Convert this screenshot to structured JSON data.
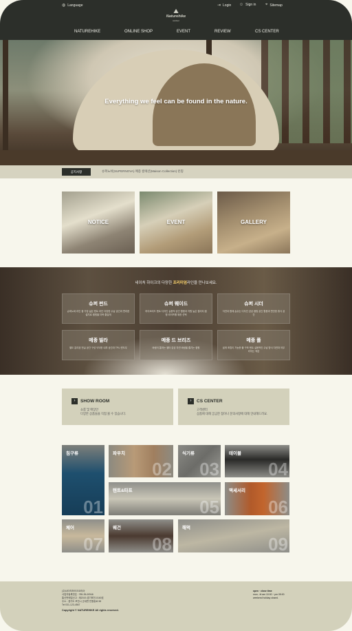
{
  "utility": {
    "language": "Language",
    "login": "Login",
    "signin": "Sign in",
    "sitemap": "Sitemap"
  },
  "logo": {
    "name": "Naturehike",
    "sub": "outdoor"
  },
  "nav": [
    "NATUREHIKE",
    "ONLINE SHOP",
    "EVENT",
    "REVIEW",
    "CS CENTER"
  ],
  "hero": {
    "headline": "Everything we feel can be found in the nature."
  },
  "notice": {
    "tag": "공지사항",
    "text": "슈퍼노바(SUPERNOVA) 메종 컬렉션(Maison Collection) 런칭"
  },
  "cards": [
    "NOTICE",
    "EVENT",
    "GALLERY"
  ],
  "brands": {
    "intro_pre": "네이처 하이크의 다양한 ",
    "intro_highlight": "프리미엄",
    "intro_post": "라인을 만나보세요.",
    "items": [
      {
        "title": "슈퍼 펀드",
        "desc": "슈퍼노바 라인 중 가장 넓은 텐트 라인 다양한 수납 공간과 편리한 설치로 캠핑을 더욱 즐겁게"
      },
      {
        "title": "슈퍼 웨이드",
        "desc": "하이브리드 텐트 디자인 실용적 공간 활용과 차원 높은 퀄리티 캠핑 라이프를 위한 선택"
      },
      {
        "title": "슈퍼 시더",
        "desc": "자연과 함께 숨쉬는 디자인 감성 캠핑 공간 활용과 편안한 휴식 공간"
      },
      {
        "title": "메종 빌라",
        "desc": "별도 분리된 전실 공간 구성 넉넉한 내부 공간과 TPU 윈도우"
      },
      {
        "title": "메종 드 브리즈",
        "desc": "바람이 통하는 쉘터 감성 자연 바람을 즐기는 캠핑"
      },
      {
        "title": "메종 폴",
        "desc": "쉽게 조립이 가능한 폴 구조 텐트 실용적인 수납 방식 자연과 어우러지는 색감"
      }
    ]
  },
  "showroom": {
    "title": "SHOW ROOM",
    "desc1": "쇼룸 및 매장안",
    "desc2": "다양한 상품들을 직접 볼 수 있습니다."
  },
  "cs": {
    "title": "CS CENTER",
    "desc1": "고객센터",
    "desc2": "상품에 대해 궁금한 점이나 문의사항에 대해 안내해드려요."
  },
  "categories": [
    {
      "label": "침구류",
      "num": "01"
    },
    {
      "label": "파우치",
      "num": "02"
    },
    {
      "label": "식기류",
      "num": "03"
    },
    {
      "label": "테이블",
      "num": "04"
    },
    {
      "label": "텐트&타프",
      "num": "05"
    },
    {
      "label": "액세서리",
      "num": "06"
    },
    {
      "label": "체어",
      "num": "07"
    },
    {
      "label": "웨건",
      "num": "08"
    },
    {
      "label": "해먹",
      "num": "09"
    }
  ],
  "footer": {
    "line1": "(주)네이처하이크코리아",
    "line2": "사업자등록번호 : 785-35-00946",
    "line3": "통신판매업신고 : 제2019-경기포천-0160호",
    "line4": "주소 : 경기도 포천시 군내면 반월동로 58",
    "line5": "Tel 031-123-4567",
    "copyright": "Copyright © NATUREHIKE All rights reserved.",
    "open1": "open · close time",
    "open2": "mon - fri am 10:00 ~ pm 05:00",
    "open3": "weekend holiday closed."
  },
  "colors": {
    "header": "#2c2f2a",
    "accent": "#d3d1bb",
    "background": "#f7f6ec"
  }
}
